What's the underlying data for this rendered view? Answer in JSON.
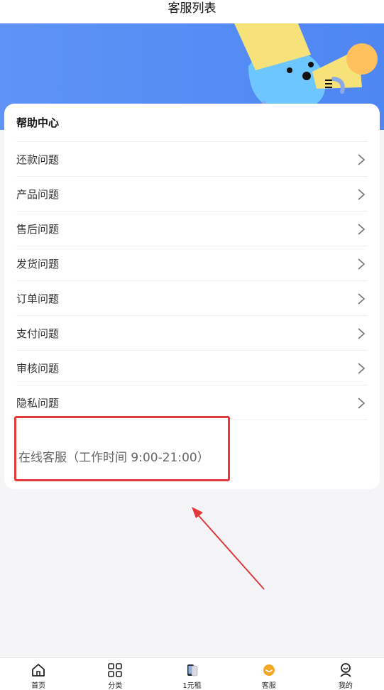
{
  "header": {
    "title": "客服列表"
  },
  "help": {
    "title": "帮助中心",
    "items": [
      {
        "label": "还款问题"
      },
      {
        "label": "产品问题"
      },
      {
        "label": "售后问题"
      },
      {
        "label": "发货问题"
      },
      {
        "label": "订单问题"
      },
      {
        "label": "支付问题"
      },
      {
        "label": "审核问题"
      },
      {
        "label": "隐私问题"
      }
    ]
  },
  "service": {
    "text": "在线客服（工作时间 9:00-21:00）"
  },
  "tabbar": {
    "items": [
      {
        "label": "首页",
        "icon": "home-icon"
      },
      {
        "label": "分类",
        "icon": "grid-icon"
      },
      {
        "label": "1元租",
        "icon": "phone-icon"
      },
      {
        "label": "客服",
        "icon": "smile-icon"
      },
      {
        "label": "我的",
        "icon": "user-icon"
      }
    ]
  },
  "colors": {
    "banner": "#4e86f3",
    "highlight_border": "#e23a3a",
    "active_tab_icon": "#f5a623"
  }
}
